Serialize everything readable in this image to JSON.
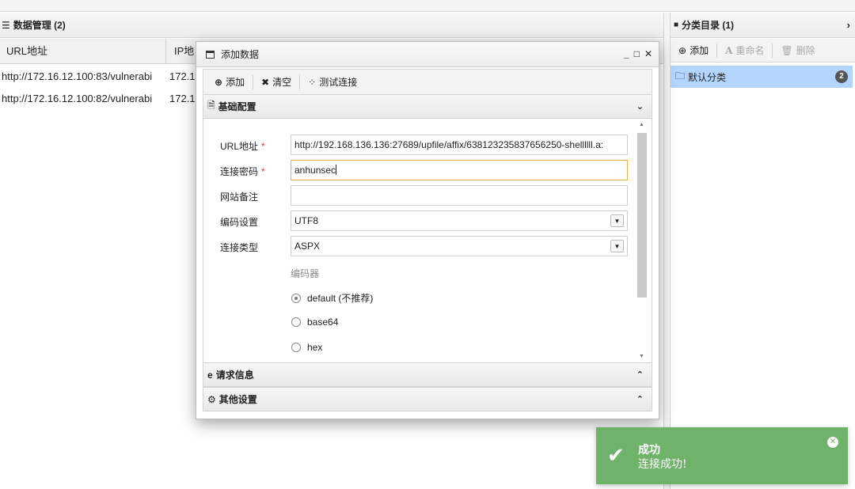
{
  "data_panel": {
    "title": "数据管理 (2)",
    "columns": [
      "URL地址",
      "IP地"
    ],
    "rows": [
      {
        "url": "http://172.16.12.100:83/vulnerabi",
        "ip": "172.1"
      },
      {
        "url": "http://172.16.12.100:82/vulnerabi",
        "ip": "172.1"
      }
    ]
  },
  "category_panel": {
    "title": "分类目录 (1)",
    "toolbar": {
      "add": "添加",
      "rename": "重命名",
      "delete": "删除"
    },
    "items": [
      {
        "label": "默认分类",
        "count": "2"
      }
    ]
  },
  "dialog": {
    "title": "添加数据",
    "toolbar": {
      "add": "添加",
      "clear": "清空",
      "test": "测试连接"
    },
    "sections": {
      "basic": "基础配置",
      "request": "请求信息",
      "other": "其他设置"
    },
    "fields": {
      "url_label": "URL地址",
      "url_value": "http://192.168.136.136:27689/upfile/affix/638123235837656250-shellllll.a:",
      "password_label": "连接密码",
      "password_value": "anhunsec",
      "note_label": "网站备注",
      "note_value": "",
      "encoding_label": "编码设置",
      "encoding_value": "UTF8",
      "type_label": "连接类型",
      "type_value": "ASPX",
      "required_mark": "*"
    },
    "encoder": {
      "label": "编码器",
      "options": [
        "default (不推荐)",
        "base64",
        "hex"
      ],
      "selected": "default (不推荐)"
    }
  },
  "toast": {
    "title": "成功",
    "message": "连接成功!",
    "color": "#6fb26a"
  }
}
